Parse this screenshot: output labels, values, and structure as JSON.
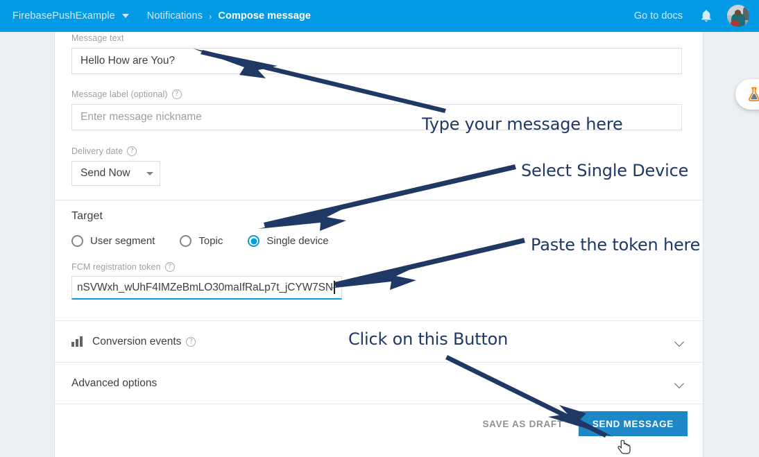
{
  "topbar": {
    "project_name": "FirebasePushExample",
    "project_caret_icon": "chevron-down-icon",
    "breadcrumb_parent": "Notifications",
    "breadcrumb_separator": "›",
    "breadcrumb_current": "Compose message",
    "docs_link": "Go to docs",
    "bell_icon": "notification-bell-icon",
    "avatar_icon": "user-avatar",
    "bg_color": "#039be5"
  },
  "compose": {
    "message_text": {
      "label": "Message text",
      "value": "Hello How are You?"
    },
    "message_label": {
      "label": "Message label (optional)",
      "help_icon": "help-circle-icon",
      "placeholder": "Enter message nickname",
      "value": ""
    },
    "delivery_date": {
      "label": "Delivery date",
      "help_icon": "help-circle-icon",
      "selected": "Send Now",
      "caret_icon": "chevron-down-icon"
    }
  },
  "target": {
    "title": "Target",
    "options": [
      {
        "label": "User segment",
        "selected": false
      },
      {
        "label": "Topic",
        "selected": false
      },
      {
        "label": "Single device",
        "selected": true
      }
    ],
    "token_field": {
      "label": "FCM registration token",
      "help_icon": "help-circle-icon",
      "value": "nSVWxh_wUhF4IMZeBmLO30maIfRaLp7t_jCYW7SN"
    },
    "accent_color": "#039be5"
  },
  "sections": [
    {
      "title": "Conversion events",
      "icon": "bar-chart-icon",
      "help_icon": "help-circle-icon",
      "chevron_icon": "chevron-down-icon",
      "has_icon": true,
      "has_help": true
    },
    {
      "title": "Advanced options",
      "icon": "",
      "help_icon": "",
      "chevron_icon": "chevron-down-icon",
      "has_icon": false,
      "has_help": false
    }
  ],
  "footer": {
    "save_draft_label": "SAVE AS DRAFT",
    "send_label": "SEND MESSAGE",
    "send_bg_color": "#1e88c7"
  },
  "fab": {
    "icon": "lab-beaker-icon"
  },
  "annotations": {
    "color": "#1f3864",
    "message": "Type your message here",
    "single_device": "Select Single Device",
    "token": "Paste the token here",
    "button": "Click on this Button"
  },
  "cursor": {
    "icon": "hand-pointer-cursor"
  }
}
